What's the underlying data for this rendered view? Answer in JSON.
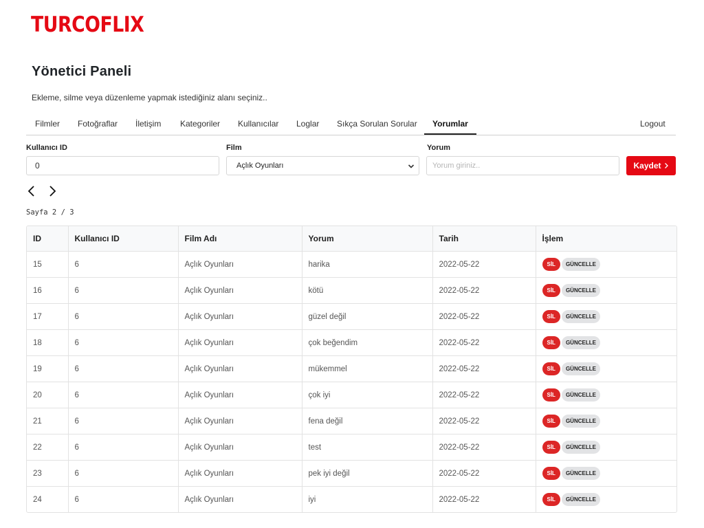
{
  "brand": {
    "logo": "TURCOFLIX",
    "color": "#e50914"
  },
  "header": {
    "title": "Yönetici Paneli",
    "subtitle": "Ekleme, silme veya düzenleme yapmak istediğiniz alanı seçiniz.."
  },
  "tabs": [
    {
      "label": "Filmler"
    },
    {
      "label": "Fotoğraflar"
    },
    {
      "label": "İletişim"
    },
    {
      "label": "Kategoriler"
    },
    {
      "label": "Kullanıcılar"
    },
    {
      "label": "Loglar"
    },
    {
      "label": "Sıkça Sorulan Sorular"
    },
    {
      "label": "Yorumlar",
      "active": true
    },
    {
      "label": "Logout"
    }
  ],
  "form": {
    "user_id_label": "Kullanıcı ID",
    "user_id_value": "0",
    "film_label": "Film",
    "film_selected": "Açlık Oyunları",
    "comment_label": "Yorum",
    "comment_placeholder": "Yorum giriniz..",
    "save_label": "Kaydet"
  },
  "pager": {
    "text": "Sayfa 2 / 3",
    "current": 2,
    "total": 3
  },
  "table": {
    "headers": [
      "ID",
      "Kullanıcı ID",
      "Film Adı",
      "Yorum",
      "Tarih",
      "İşlem"
    ],
    "delete_label": "SİL",
    "update_label": "GÜNCELLE",
    "rows": [
      {
        "id": "15",
        "user_id": "6",
        "film": "Açlık Oyunları",
        "comment": "harika",
        "date": "2022-05-22"
      },
      {
        "id": "16",
        "user_id": "6",
        "film": "Açlık Oyunları",
        "comment": "kötü",
        "date": "2022-05-22"
      },
      {
        "id": "17",
        "user_id": "6",
        "film": "Açlık Oyunları",
        "comment": "güzel değil",
        "date": "2022-05-22"
      },
      {
        "id": "18",
        "user_id": "6",
        "film": "Açlık Oyunları",
        "comment": "çok beğendim",
        "date": "2022-05-22"
      },
      {
        "id": "19",
        "user_id": "6",
        "film": "Açlık Oyunları",
        "comment": "mükemmel",
        "date": "2022-05-22"
      },
      {
        "id": "20",
        "user_id": "6",
        "film": "Açlık Oyunları",
        "comment": "çok iyi",
        "date": "2022-05-22"
      },
      {
        "id": "21",
        "user_id": "6",
        "film": "Açlık Oyunları",
        "comment": "fena değil",
        "date": "2022-05-22"
      },
      {
        "id": "22",
        "user_id": "6",
        "film": "Açlık Oyunları",
        "comment": "test",
        "date": "2022-05-22"
      },
      {
        "id": "23",
        "user_id": "6",
        "film": "Açlık Oyunları",
        "comment": "pek iyi değil",
        "date": "2022-05-22"
      },
      {
        "id": "24",
        "user_id": "6",
        "film": "Açlık Oyunları",
        "comment": "iyi",
        "date": "2022-05-22"
      }
    ]
  },
  "icons": {
    "prev": "chevron-left-icon",
    "next": "chevron-right-icon",
    "select": "chevron-down-icon",
    "save": "chevron-right-icon"
  },
  "colors": {
    "accent": "#e50914",
    "delete": "#dc2626",
    "update": "#e2e3e5"
  }
}
